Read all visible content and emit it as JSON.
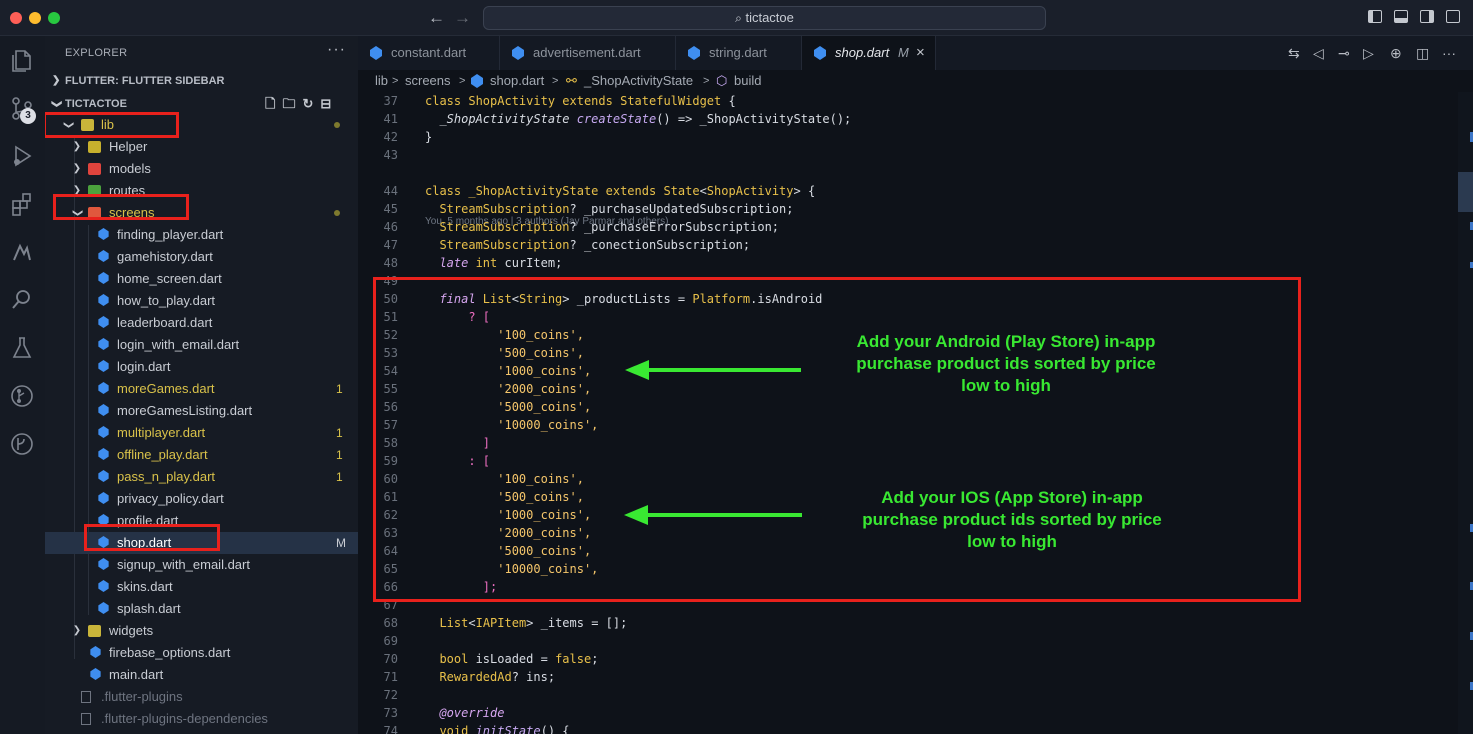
{
  "titlebar": {
    "search_text": "tictactoe",
    "back_icon": "arrow-left-icon",
    "forward_icon": "arrow-right-icon"
  },
  "activity_bar": {
    "items": [
      "explorer-icon",
      "source-control-icon",
      "run-debug-icon",
      "extensions-icon",
      "flutter-icon",
      "search-icon",
      "testing-icon",
      "git-graph-icon",
      "gitlens-icon"
    ],
    "scm_badge": "3"
  },
  "explorer": {
    "title": "EXPLORER",
    "more": "···",
    "section_flutter": "FLUTTER: FLUTTER SIDEBAR",
    "section_project": "TICTACTOE",
    "tree": [
      {
        "label": "lib",
        "badge": ""
      },
      {
        "label": "Helper",
        "badge": ""
      },
      {
        "label": "models",
        "badge": ""
      },
      {
        "label": "routes",
        "badge": ""
      },
      {
        "label": "screens",
        "badge": ""
      },
      {
        "label": "finding_player.dart",
        "badge": ""
      },
      {
        "label": "gamehistory.dart",
        "badge": ""
      },
      {
        "label": "home_screen.dart",
        "badge": ""
      },
      {
        "label": "how_to_play.dart",
        "badge": ""
      },
      {
        "label": "leaderboard.dart",
        "badge": ""
      },
      {
        "label": "login_with_email.dart",
        "badge": ""
      },
      {
        "label": "login.dart",
        "badge": ""
      },
      {
        "label": "moreGames.dart",
        "badge": "1"
      },
      {
        "label": "moreGamesListing.dart",
        "badge": ""
      },
      {
        "label": "multiplayer.dart",
        "badge": "1"
      },
      {
        "label": "offline_play.dart",
        "badge": "1"
      },
      {
        "label": "pass_n_play.dart",
        "badge": "1"
      },
      {
        "label": "privacy_policy.dart",
        "badge": ""
      },
      {
        "label": "profile.dart",
        "badge": ""
      },
      {
        "label": "shop.dart",
        "badge": "M"
      },
      {
        "label": "signup_with_email.dart",
        "badge": ""
      },
      {
        "label": "skins.dart",
        "badge": ""
      },
      {
        "label": "splash.dart",
        "badge": ""
      },
      {
        "label": "widgets",
        "badge": ""
      },
      {
        "label": "firebase_options.dart",
        "badge": ""
      },
      {
        "label": "main.dart",
        "badge": ""
      },
      {
        "label": ".flutter-plugins",
        "badge": ""
      },
      {
        "label": ".flutter-plugins-dependencies",
        "badge": ""
      }
    ]
  },
  "tabs": [
    {
      "label": "constant.dart"
    },
    {
      "label": "advertisement.dart"
    },
    {
      "label": "string.dart"
    },
    {
      "label": "shop.dart",
      "modified": "M",
      "close": "×"
    }
  ],
  "breadcrumb": {
    "items": [
      "lib",
      ">",
      "screens",
      ">",
      "shop.dart",
      ">",
      "_ShopActivityState",
      ">",
      "build"
    ]
  },
  "code": {
    "blame": "You, 5 months ago | 3 authors (Jay Parmar and others)",
    "line_numbers": [
      "37",
      "41",
      "42",
      "43",
      "44",
      "45",
      "46",
      "47",
      "48",
      "49",
      "50",
      "51",
      "52",
      "53",
      "54",
      "55",
      "56",
      "57",
      "58",
      "59",
      "60",
      "61",
      "62",
      "63",
      "64",
      "65",
      "66",
      "67",
      "68",
      "69",
      "70",
      "71",
      "72",
      "73",
      "74"
    ],
    "lines": {
      "l37": [
        "class ",
        "ShopActivity",
        " extends ",
        "StatefulWidget",
        " {"
      ],
      "l41": [
        "  _ShopActivityState ",
        "createState",
        "() => _ShopActivityState();"
      ],
      "l42": [
        "}"
      ],
      "l44": [
        "class ",
        "_ShopActivityState",
        " extends ",
        "State",
        "<",
        "ShopActivity",
        "> {"
      ],
      "l45": [
        "  StreamSubscription",
        "? _purchaseUpdatedSubscription;"
      ],
      "l46": [
        "  StreamSubscription",
        "? _purchaseErrorSubscription;"
      ],
      "l47": [
        "  StreamSubscription",
        "? _conectionSubscription;"
      ],
      "l48": [
        "  late ",
        "int",
        " curItem;"
      ],
      "l50": [
        "  final ",
        "List",
        "<",
        "String",
        "> _productLists = ",
        "Platform",
        ".isAndroid"
      ],
      "l51": [
        "      ? ["
      ],
      "l52": [
        "          '100_coins',"
      ],
      "l53": [
        "          '500_coins',"
      ],
      "l54": [
        "          '1000_coins',"
      ],
      "l55": [
        "          '2000_coins',"
      ],
      "l56": [
        "          '5000_coins',"
      ],
      "l57": [
        "          '10000_coins',"
      ],
      "l58": [
        "        ]"
      ],
      "l59": [
        "      : ["
      ],
      "l60": [
        "          '100_coins',"
      ],
      "l61": [
        "          '500_coins',"
      ],
      "l62": [
        "          '1000_coins',"
      ],
      "l63": [
        "          '2000_coins',"
      ],
      "l64": [
        "          '5000_coins',"
      ],
      "l65": [
        "          '10000_coins',"
      ],
      "l66": [
        "        ];"
      ],
      "l68": [
        "  List",
        "<",
        "IAPItem",
        "> _items = [];"
      ],
      "l70": [
        "  bool",
        " isLoaded = ",
        "false",
        ";"
      ],
      "l71": [
        "  RewardedAd",
        "? ins;"
      ],
      "l73": [
        "  @override"
      ],
      "l74": [
        "  void ",
        "initState",
        "() {"
      ]
    }
  },
  "annotations": {
    "android": [
      "Add your Android (Play Store) in-app",
      "purchase product ids sorted by price",
      "low to high"
    ],
    "ios": [
      "Add your IOS (App Store) in-app",
      "purchase product ids sorted by price",
      "low to high"
    ]
  },
  "colors": {
    "highlight_box": "#e8211c",
    "annotation": "#39e832",
    "keyword": "#e8c04a",
    "string": "#f5c66b"
  }
}
